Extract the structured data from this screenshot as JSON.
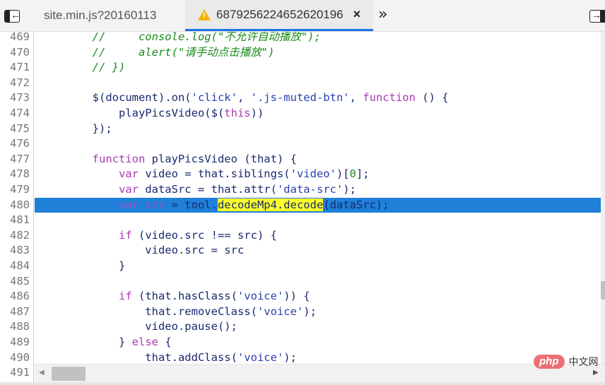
{
  "tabs": [
    {
      "label": "site.min.js?20160113",
      "active": false,
      "warning": false
    },
    {
      "label": "6879256224652620196",
      "active": true,
      "warning": true
    }
  ],
  "icons": {
    "toggle_left": "←",
    "toggle_right": "→",
    "warning": "!",
    "close": "×",
    "more_tabs": "»",
    "scroll_left": "◀",
    "scroll_right": "▶"
  },
  "editor": {
    "highlighted_line": 480,
    "lines": [
      {
        "n": "469",
        "tokens": [
          {
            "t": "        //     console.log(\"不允许自动播放\");",
            "c": "com"
          }
        ]
      },
      {
        "n": "470",
        "tokens": [
          {
            "t": "        //     alert(\"请手动点击播放\")",
            "c": "com"
          }
        ]
      },
      {
        "n": "471",
        "tokens": [
          {
            "t": "        // })",
            "c": "com"
          }
        ]
      },
      {
        "n": "472",
        "tokens": []
      },
      {
        "n": "473",
        "tokens": [
          {
            "t": "        $(document).on(",
            "c": "id"
          },
          {
            "t": "'click'",
            "c": "str"
          },
          {
            "t": ", ",
            "c": "id"
          },
          {
            "t": "'.js-muted-btn'",
            "c": "str"
          },
          {
            "t": ", ",
            "c": "id"
          },
          {
            "t": "function",
            "c": "kw"
          },
          {
            "t": " () {",
            "c": "id"
          }
        ]
      },
      {
        "n": "474",
        "tokens": [
          {
            "t": "            playPicsVideo($(",
            "c": "id"
          },
          {
            "t": "this",
            "c": "kw"
          },
          {
            "t": "))",
            "c": "id"
          }
        ]
      },
      {
        "n": "475",
        "tokens": [
          {
            "t": "        });",
            "c": "id"
          }
        ]
      },
      {
        "n": "476",
        "tokens": []
      },
      {
        "n": "477",
        "tokens": [
          {
            "t": "        ",
            "c": "id"
          },
          {
            "t": "function",
            "c": "kw"
          },
          {
            "t": " playPicsVideo (that) {",
            "c": "id"
          }
        ]
      },
      {
        "n": "478",
        "tokens": [
          {
            "t": "            ",
            "c": "id"
          },
          {
            "t": "var",
            "c": "kw"
          },
          {
            "t": " video = that.siblings(",
            "c": "id"
          },
          {
            "t": "'video'",
            "c": "str"
          },
          {
            "t": ")[",
            "c": "id"
          },
          {
            "t": "0",
            "c": "num"
          },
          {
            "t": "];",
            "c": "id"
          }
        ]
      },
      {
        "n": "479",
        "tokens": [
          {
            "t": "            ",
            "c": "id"
          },
          {
            "t": "var",
            "c": "kw"
          },
          {
            "t": " dataSrc = that.attr(",
            "c": "id"
          },
          {
            "t": "'data-src'",
            "c": "str"
          },
          {
            "t": ");",
            "c": "id"
          }
        ]
      },
      {
        "n": "480",
        "tokens": [
          {
            "t": "            ",
            "c": "id"
          },
          {
            "t": "var",
            "c": "kw"
          },
          {
            "t": " src",
            "c": "kw"
          },
          {
            "t": " = tool.",
            "c": "id"
          },
          {
            "t": "decodeMp4.decode",
            "c": "yel"
          },
          {
            "t": "(dataSrc);",
            "c": "id"
          }
        ]
      },
      {
        "n": "481",
        "tokens": []
      },
      {
        "n": "482",
        "tokens": [
          {
            "t": "            ",
            "c": "id"
          },
          {
            "t": "if",
            "c": "kw"
          },
          {
            "t": " (video.src !== src) {",
            "c": "id"
          }
        ]
      },
      {
        "n": "483",
        "tokens": [
          {
            "t": "                video.src = src",
            "c": "id"
          }
        ]
      },
      {
        "n": "484",
        "tokens": [
          {
            "t": "            }",
            "c": "id"
          }
        ]
      },
      {
        "n": "485",
        "tokens": []
      },
      {
        "n": "486",
        "tokens": [
          {
            "t": "            ",
            "c": "id"
          },
          {
            "t": "if",
            "c": "kw"
          },
          {
            "t": " (that.hasClass(",
            "c": "id"
          },
          {
            "t": "'voice'",
            "c": "str"
          },
          {
            "t": ")) {",
            "c": "id"
          }
        ]
      },
      {
        "n": "487",
        "tokens": [
          {
            "t": "                that.removeClass(",
            "c": "id"
          },
          {
            "t": "'voice'",
            "c": "str"
          },
          {
            "t": ");",
            "c": "id"
          }
        ]
      },
      {
        "n": "488",
        "tokens": [
          {
            "t": "                video.pause();",
            "c": "id"
          }
        ]
      },
      {
        "n": "489",
        "tokens": [
          {
            "t": "            } ",
            "c": "id"
          },
          {
            "t": "else",
            "c": "kw"
          },
          {
            "t": " {",
            "c": "id"
          }
        ]
      },
      {
        "n": "490",
        "tokens": [
          {
            "t": "                that.addClass(",
            "c": "id"
          },
          {
            "t": "'voice'",
            "c": "str"
          },
          {
            "t": ");",
            "c": "id"
          }
        ]
      }
    ],
    "last_line_number": "491"
  },
  "watermark": {
    "logo": "php",
    "text": "中文网"
  },
  "colors": {
    "accent": "#1a73e8",
    "highlight_line": "#1e80d8",
    "search_match": "#ffff2a",
    "warning": "#f4b400",
    "comment": "#1b8a1b",
    "keyword": "#a93aaf",
    "string": "#2a3fb0"
  }
}
